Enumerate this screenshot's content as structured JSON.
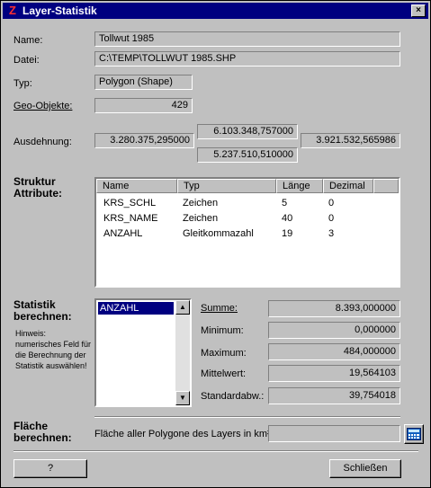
{
  "window": {
    "title": "Layer-Statistik",
    "close_label": "×"
  },
  "general": {
    "name_label": "Name:",
    "name_value": "Tollwut 1985",
    "file_label": "Datei:",
    "file_value": "C:\\TEMP\\TOLLWUT 1985.SHP",
    "type_label": "Typ:",
    "type_value": "Polygon (Shape)",
    "geo_label": "Geo-Objekte:",
    "geo_value": "429"
  },
  "extent": {
    "label": "Ausdehnung:",
    "left": "3.280.375,295000",
    "top": "6.103.348,757000",
    "bottom": "5.237.510,510000",
    "right": "3.921.532,565986"
  },
  "structure": {
    "label_line1": "Struktur",
    "label_line2": "Attribute:",
    "columns": [
      "Name",
      "Typ",
      "Länge",
      "Dezimal"
    ],
    "rows": [
      [
        "KRS_SCHL",
        "Zeichen",
        "5",
        "0"
      ],
      [
        "KRS_NAME",
        "Zeichen",
        "40",
        "0"
      ],
      [
        "ANZAHL",
        "Gleitkommazahl",
        "19",
        "3"
      ]
    ]
  },
  "statistics": {
    "label_line1": "Statistik",
    "label_line2": "berechnen:",
    "hint": "Hinweis: numerisches Feld für die Berechnung der Statistik auswählen!",
    "fields": [
      "ANZAHL"
    ],
    "sum_label": "Summe:",
    "sum_value": "8.393,000000",
    "min_label": "Minimum:",
    "min_value": "0,000000",
    "max_label": "Maximum:",
    "max_value": "484,000000",
    "mean_label": "Mittelwert:",
    "mean_value": "19,564103",
    "std_label": "Standardabw.:",
    "std_value": "39,754018"
  },
  "area": {
    "label_line1": "Fläche",
    "label_line2": "berechnen:",
    "text": "Fläche aller Polygone des Layers in km²:",
    "value": ""
  },
  "buttons": {
    "help": "?",
    "close": "Schließen"
  }
}
